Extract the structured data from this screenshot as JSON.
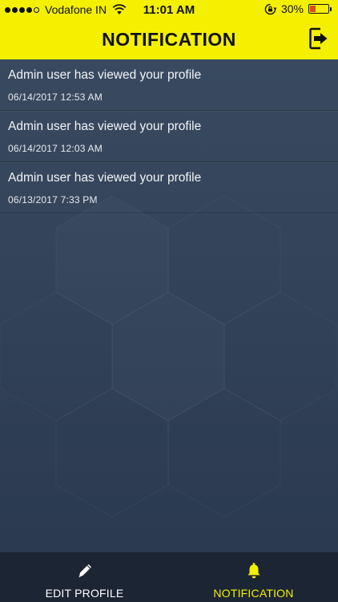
{
  "status_bar": {
    "carrier": "Vodafone IN",
    "time": "11:01 AM",
    "battery_percent": "30%",
    "battery_level": 0.3,
    "signal_bars": 4,
    "signal_max": 5,
    "icons": [
      "wifi-icon",
      "rotation-lock-icon",
      "battery-icon"
    ]
  },
  "header": {
    "title": "NOTIFICATION",
    "logout_icon": "logout-icon"
  },
  "notifications": [
    {
      "message": "Admin user has viewed your profile",
      "time": "06/14/2017 12:53 AM"
    },
    {
      "message": "Admin user has viewed your profile",
      "time": "06/14/2017 12:03 AM"
    },
    {
      "message": "Admin user has viewed your profile",
      "time": "06/13/2017 7:33 PM"
    }
  ],
  "tabbar": {
    "tabs": [
      {
        "label": "EDIT PROFILE",
        "icon": "pencil-icon",
        "active": false
      },
      {
        "label": "NOTIFICATION",
        "icon": "bell-icon",
        "active": true
      }
    ]
  },
  "colors": {
    "accent": "#f5f000",
    "background": "#2f3e52",
    "tabbar": "#1c2534"
  }
}
